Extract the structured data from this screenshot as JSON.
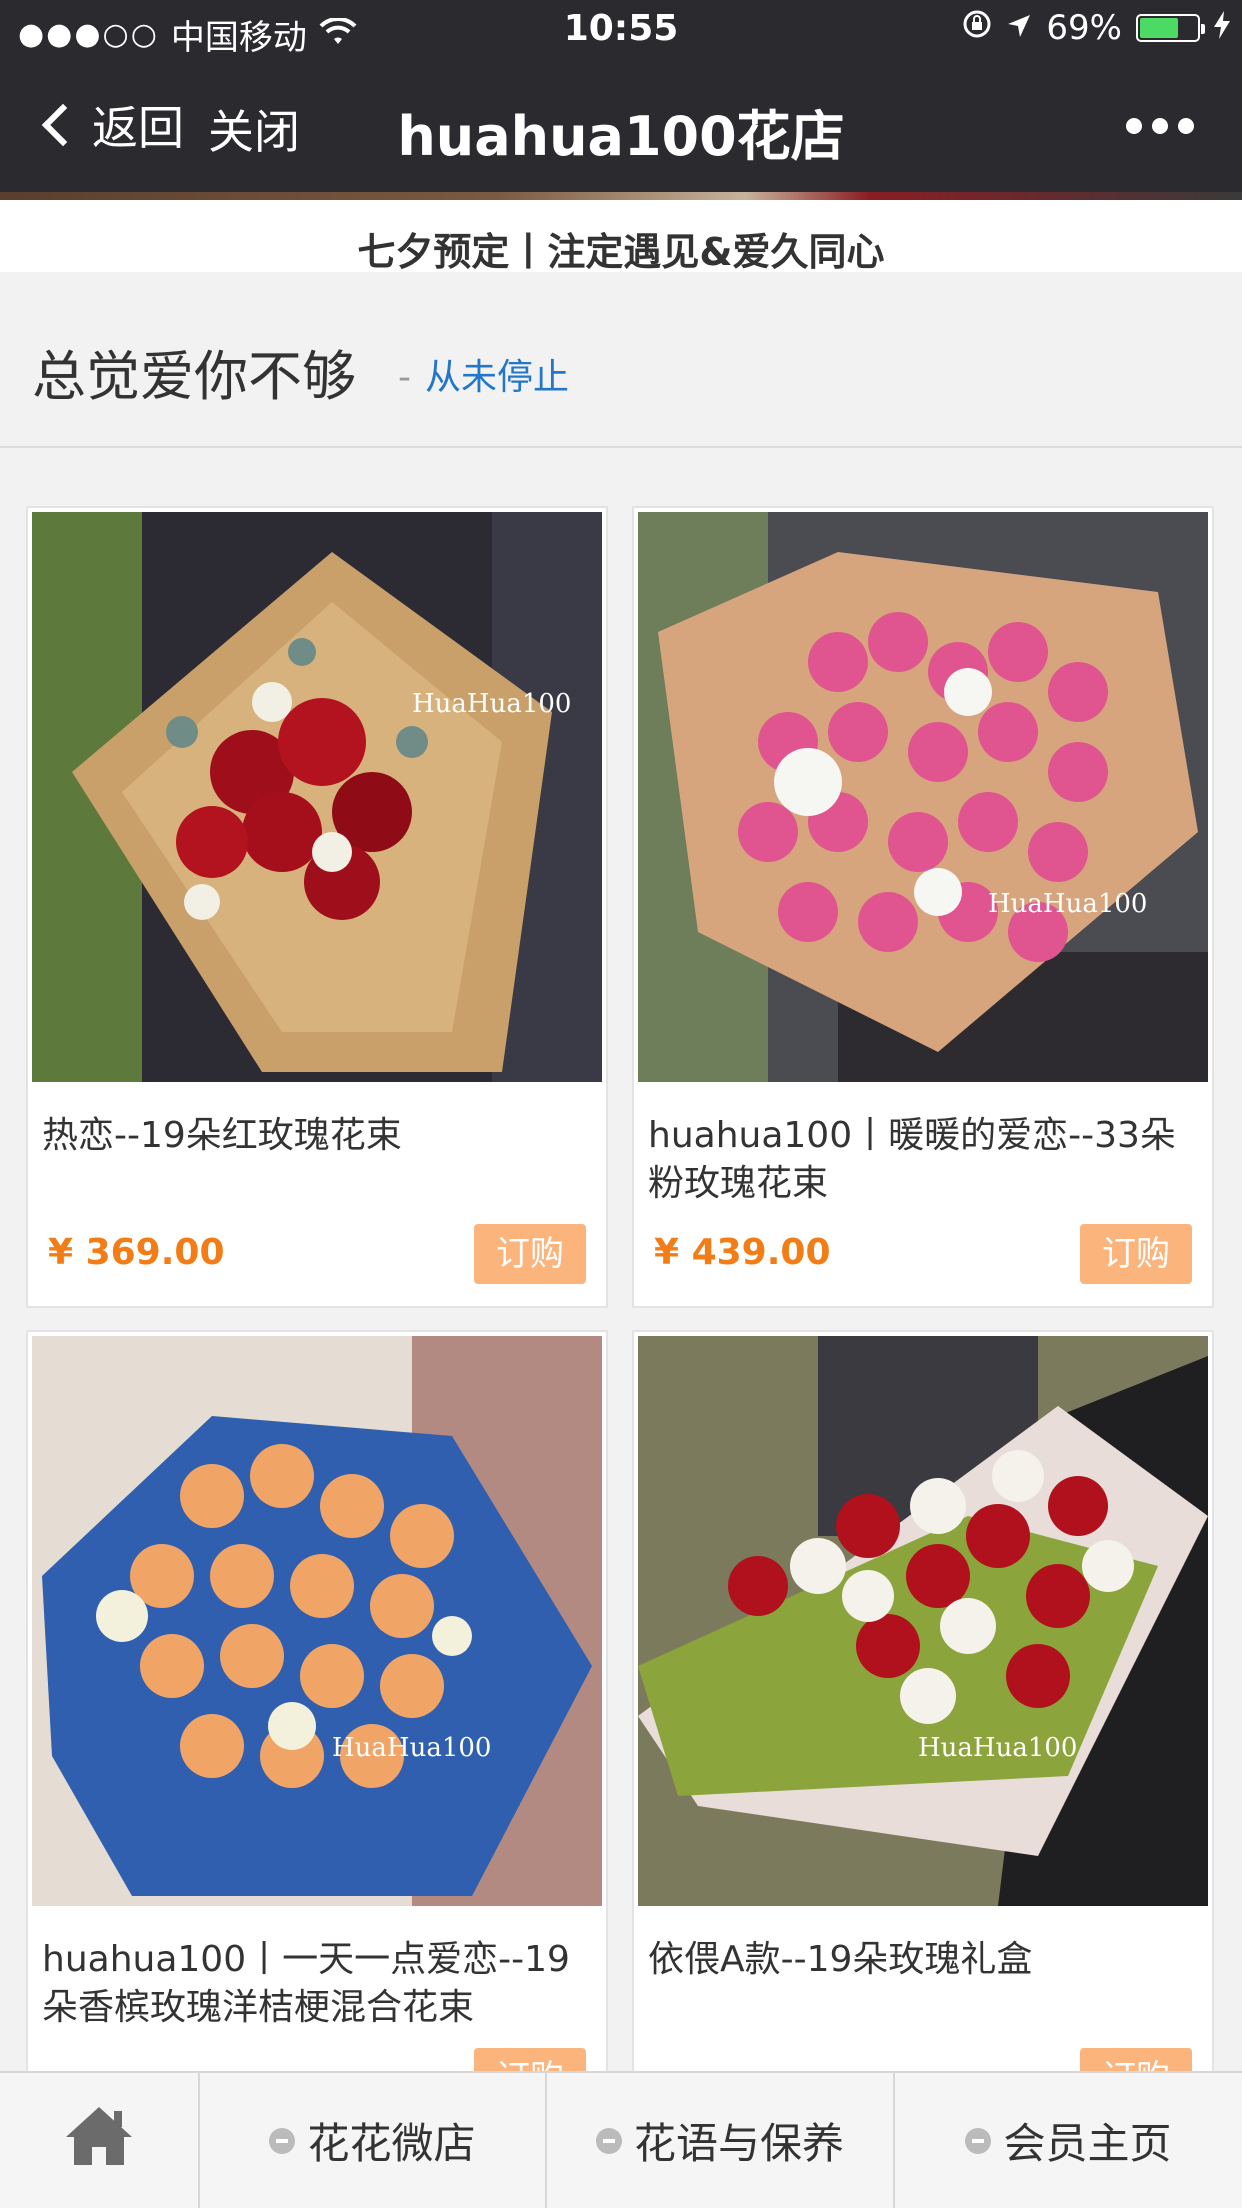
{
  "status_bar": {
    "carrier": "中国移动",
    "time": "10:55",
    "battery_percent_label": "69%",
    "battery_level": 0.69
  },
  "nav": {
    "back_label": "返回",
    "close_label": "关闭",
    "title": "huahua100花店"
  },
  "promo_text": "七夕预定丨注定遇见&爱久同心",
  "section": {
    "title": "总觉爱你不够",
    "dash": "-",
    "subtitle": "从未停止"
  },
  "products": [
    {
      "name": "热恋--19朵红玫瑰花束",
      "price": "¥ 369.00",
      "buy_label": "订购",
      "image_icon": "red-rose-bouquet",
      "watermark": "HuaHua100"
    },
    {
      "name": "huahua100丨暖暖的爱恋--33朵粉玫瑰花束",
      "price": "¥ 439.00",
      "buy_label": "订购",
      "image_icon": "pink-rose-bouquet",
      "watermark": "HuaHua100"
    },
    {
      "name": "huahua100丨一天一点爱恋--19朵香槟玫瑰洋桔梗混合花束",
      "price": "",
      "buy_label": "订购",
      "image_icon": "champagne-rose-bouquet",
      "watermark": "HuaHua100"
    },
    {
      "name": "依偎A款--19朵玫瑰礼盒",
      "price": "",
      "buy_label": "订购",
      "image_icon": "rose-gift-box",
      "watermark": "HuaHua100"
    }
  ],
  "tabs": [
    {
      "label": "",
      "icon": "home-icon"
    },
    {
      "label": "花花微店",
      "icon": "minus-circle-icon"
    },
    {
      "label": "花语与保养",
      "icon": "minus-circle-icon"
    },
    {
      "label": "会员主页",
      "icon": "minus-circle-icon"
    }
  ],
  "colors": {
    "nav_bg": "#2b2a2f",
    "link_blue": "#2377c8",
    "price_orange": "#f27d17",
    "buy_button": "#fbb57c",
    "battery_green": "#4cd964"
  }
}
